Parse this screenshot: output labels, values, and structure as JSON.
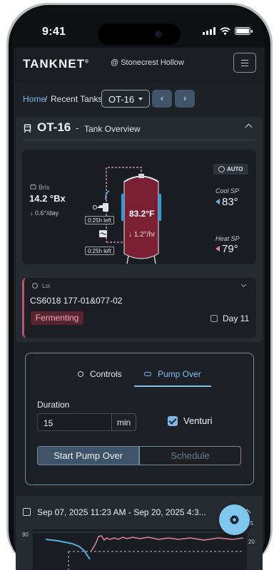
{
  "statusbar": {
    "time": "9:41"
  },
  "header": {
    "logo": "TANKNET",
    "logo_mark": "®",
    "location": "@ Stonecrest Hollow"
  },
  "breadcrumb": {
    "home": "Home",
    "separator": "/",
    "current": "Recent Tanks:",
    "selected_tank": "OT-16",
    "prev_symbol": "‹",
    "next_symbol": "›"
  },
  "overview": {
    "tank_name": "OT-16",
    "separator": "-",
    "section_title": "Tank Overview",
    "brix_label": "Brix",
    "brix_value": "14.2 °Bx",
    "brix_rate": "↓ 0.6°/day",
    "mode_badge": "AUTO",
    "tank_temp": "83.2°F",
    "temp_rate": "↓ 1.2°/hr",
    "valve_top_label": "0:25h left",
    "valve_bottom_label": "0:25h left",
    "cool_sp_label": "Cool SP",
    "cool_sp_value": "83°",
    "heat_sp_label": "Heat SP",
    "heat_sp_value": "79°",
    "colors": {
      "tank": "#7a1f34",
      "cool": "#5fb8e8",
      "heat": "#e8829a"
    }
  },
  "lot": {
    "label": "Lot",
    "value": "CS6018 177-01&077-02",
    "status": "Fermenting",
    "day": "Day 11"
  },
  "pump_panel": {
    "tabs": [
      {
        "label": "Controls",
        "icon": "controls-icon"
      },
      {
        "label": "Pump Over",
        "icon": "pump-icon",
        "active": true
      }
    ],
    "duration_label": "Duration",
    "duration_value": "15",
    "duration_unit": "min",
    "venturi_label": "Venturi",
    "venturi_checked": true,
    "start_label": "Start Pump Over",
    "schedule_label": "Schedule"
  },
  "history": {
    "date_range": "Sep 07, 2025 11:23 AM  -  Sep 20, 2025  4:3...",
    "axis_left": "90",
    "axis_right_top": "25",
    "axis_right_bottom": "20"
  },
  "fab": {
    "icon": "gear-icon"
  }
}
